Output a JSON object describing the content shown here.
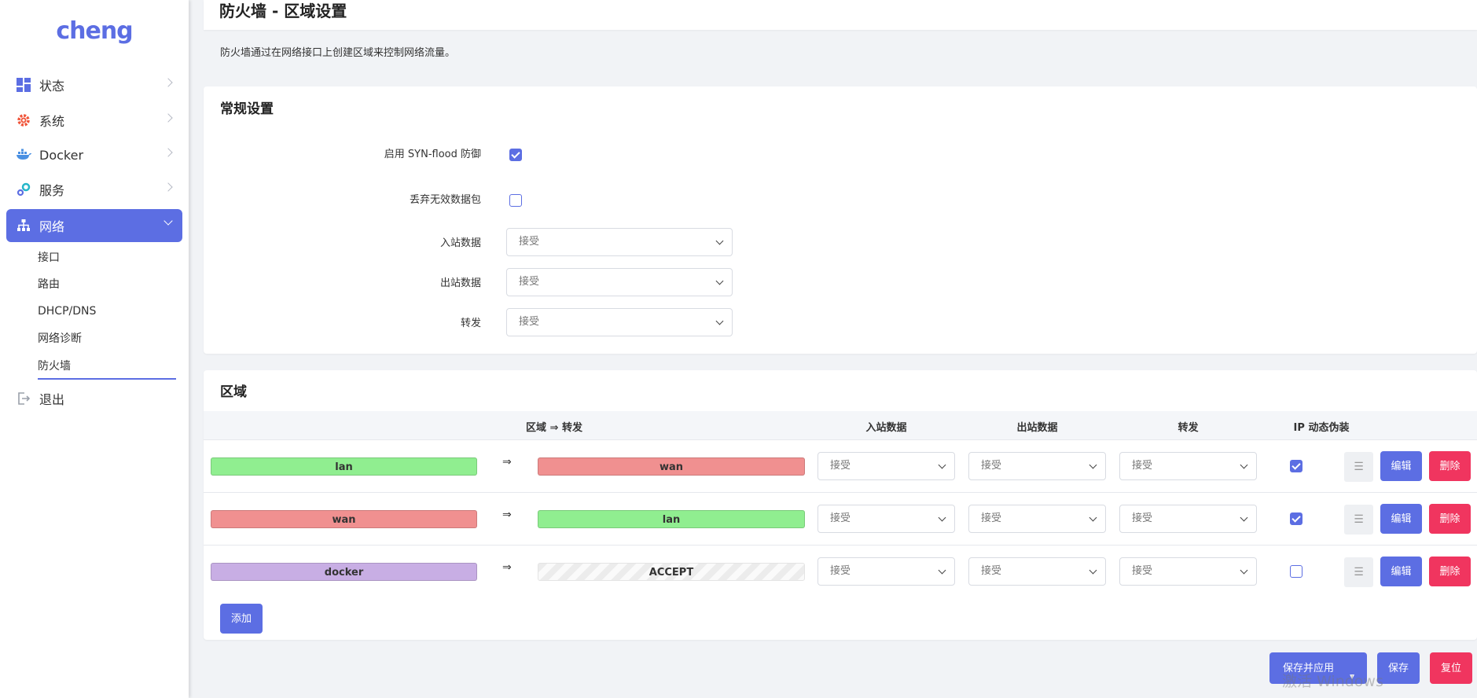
{
  "brand": {
    "logo_text": "cheng",
    "accent": "#5c6ee3",
    "danger": "#f0355f"
  },
  "sidebar": {
    "items": [
      {
        "label": "状态",
        "icon": "dashboard-icon"
      },
      {
        "label": "系统",
        "icon": "gear-icon"
      },
      {
        "label": "Docker",
        "icon": "docker-icon"
      },
      {
        "label": "服务",
        "icon": "services-icon"
      },
      {
        "label": "网络",
        "icon": "network-icon",
        "active": true
      }
    ],
    "sub_items": [
      "接口",
      "路由",
      "DHCP/DNS",
      "网络诊断",
      "防火墙"
    ],
    "logout": {
      "label": "退出",
      "icon": "logout-icon"
    }
  },
  "page": {
    "title": "防火墙 - 区域设置",
    "description": "防火墙通过在网络接口上创建区域来控制网络流量。"
  },
  "general": {
    "title": "常规设置",
    "syn_flood": {
      "label": "启用 SYN-flood 防御",
      "checked": true
    },
    "drop_invalid": {
      "label": "丢弃无效数据包",
      "checked": false
    },
    "input": {
      "label": "入站数据",
      "value": "接受"
    },
    "output": {
      "label": "出站数据",
      "value": "接受"
    },
    "forward": {
      "label": "转发",
      "value": "接受"
    }
  },
  "zones": {
    "title": "区域",
    "headers": {
      "zone_forward": "区域 ⇒ 转发",
      "input": "入站数据",
      "output": "出站数据",
      "forward": "转发",
      "masq": "IP 动态伪装"
    },
    "arrow": "⇒",
    "rows": [
      {
        "zone": "lan",
        "zone_color": "#90ee90",
        "dest": "wan",
        "dest_color": "#f09090",
        "input": "接受",
        "output": "接受",
        "forward": "接受",
        "masq": true
      },
      {
        "zone": "wan",
        "zone_color": "#f09090",
        "dest": "lan",
        "dest_color": "#90ee90",
        "input": "接受",
        "output": "接受",
        "forward": "接受",
        "masq": true
      },
      {
        "zone": "docker",
        "zone_color": "#c8aee4",
        "dest": "ACCEPT",
        "dest_color": "striped",
        "input": "接受",
        "output": "接受",
        "forward": "接受",
        "masq": false
      }
    ],
    "handle_glyph": "☰",
    "edit_label": "编辑",
    "delete_label": "删除",
    "add_label": "添加"
  },
  "footer": {
    "save_apply": "保存并应用",
    "save_apply_caret": "▼",
    "save": "保存",
    "reset": "复位"
  },
  "watermark": "激活 Windows"
}
